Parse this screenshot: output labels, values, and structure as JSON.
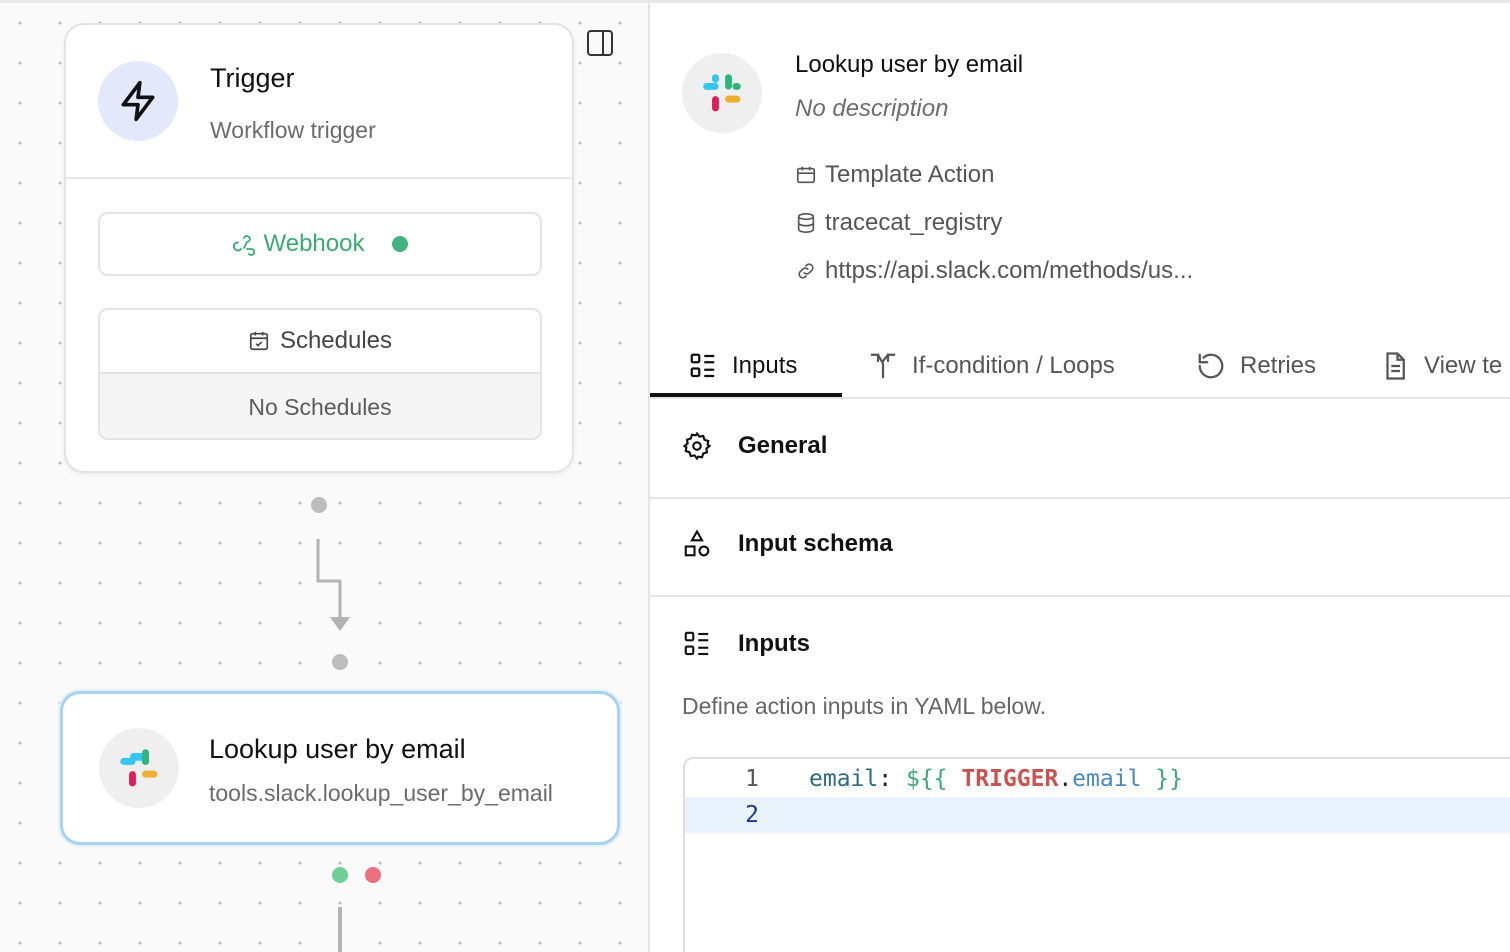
{
  "canvas": {
    "trigger_node": {
      "title": "Trigger",
      "subtitle": "Workflow trigger",
      "webhook_label": "Webhook",
      "schedules_label": "Schedules",
      "schedules_empty": "No Schedules"
    },
    "action_node": {
      "title": "Lookup user by email",
      "subtitle": "tools.slack.lookup_user_by_email"
    },
    "handle_colors": {
      "success": "#6fcf97",
      "error": "#eb6f7d",
      "neutral": "#bdbdbd"
    }
  },
  "panel": {
    "title": "Lookup user by email",
    "description": "No description",
    "meta": {
      "type": "Template Action",
      "registry": "tracecat_registry",
      "url": "https://api.slack.com/methods/us..."
    },
    "tabs": [
      {
        "label": "Inputs",
        "icon": "list-icon",
        "active": true
      },
      {
        "label": "If-condition / Loops",
        "icon": "split-icon"
      },
      {
        "label": "Retries",
        "icon": "rotate-icon"
      },
      {
        "label": "View te",
        "icon": "file-icon"
      }
    ],
    "sections": {
      "general": "General",
      "input_schema": "Input schema",
      "inputs": "Inputs"
    },
    "inputs_help": "Define action inputs in YAML below.",
    "editor": {
      "line_numbers": [
        "1",
        "2"
      ],
      "line1": {
        "key": "email",
        "colon": ":",
        "open": "${{",
        "trigger": "TRIGGER",
        "dot": ".",
        "attr": "email",
        "close": "}}"
      }
    }
  }
}
